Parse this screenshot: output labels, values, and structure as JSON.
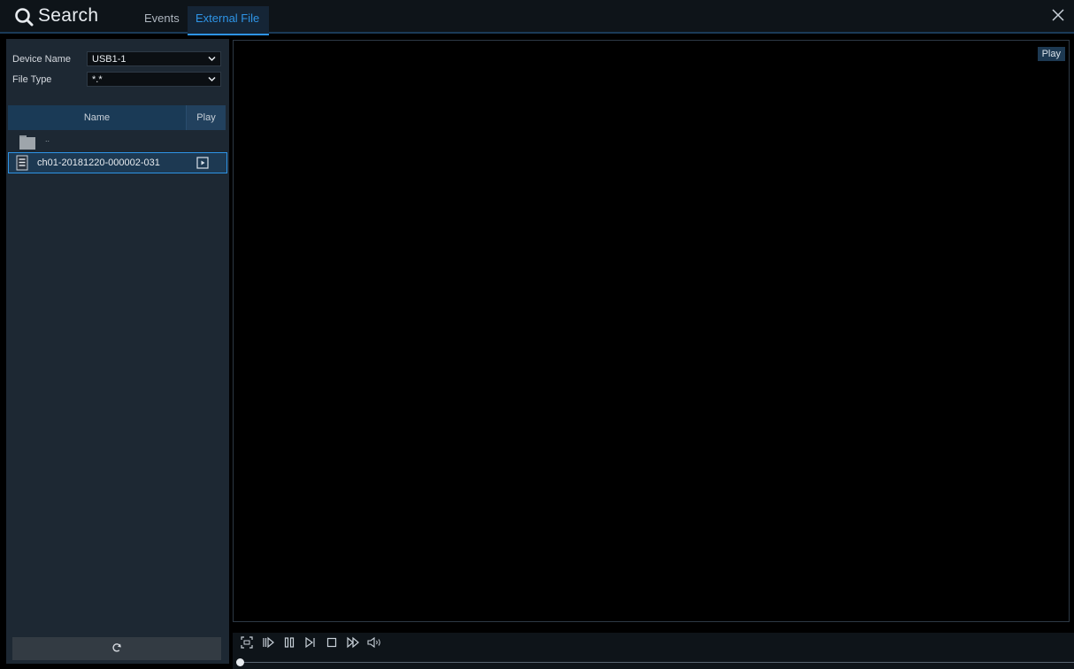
{
  "header": {
    "title": "Search",
    "tabs": [
      {
        "label": "Events",
        "active": false
      },
      {
        "label": "External File",
        "active": true
      }
    ]
  },
  "filters": {
    "device_name_label": "Device Name",
    "device_name_value": "USB1-1",
    "file_type_label": "File Type",
    "file_type_value": "*.*"
  },
  "file_table": {
    "columns": [
      "Name",
      "Play"
    ],
    "parent_entry": "..",
    "files": [
      {
        "name": "ch01-20181220-000002-031",
        "selected": true
      }
    ]
  },
  "player": {
    "play_badge": "Play",
    "progress": 0
  },
  "colors": {
    "accent": "#2e94e6",
    "panel": "#1d2833",
    "header_row": "#1a3a56"
  },
  "icons": {
    "title": "search-icon",
    "close": "close-icon",
    "refresh": "refresh-icon",
    "controls": [
      "fullscreen-icon",
      "slow-play-icon",
      "pause-icon",
      "frame-step-icon",
      "stop-icon",
      "fast-forward-icon",
      "volume-icon"
    ]
  }
}
